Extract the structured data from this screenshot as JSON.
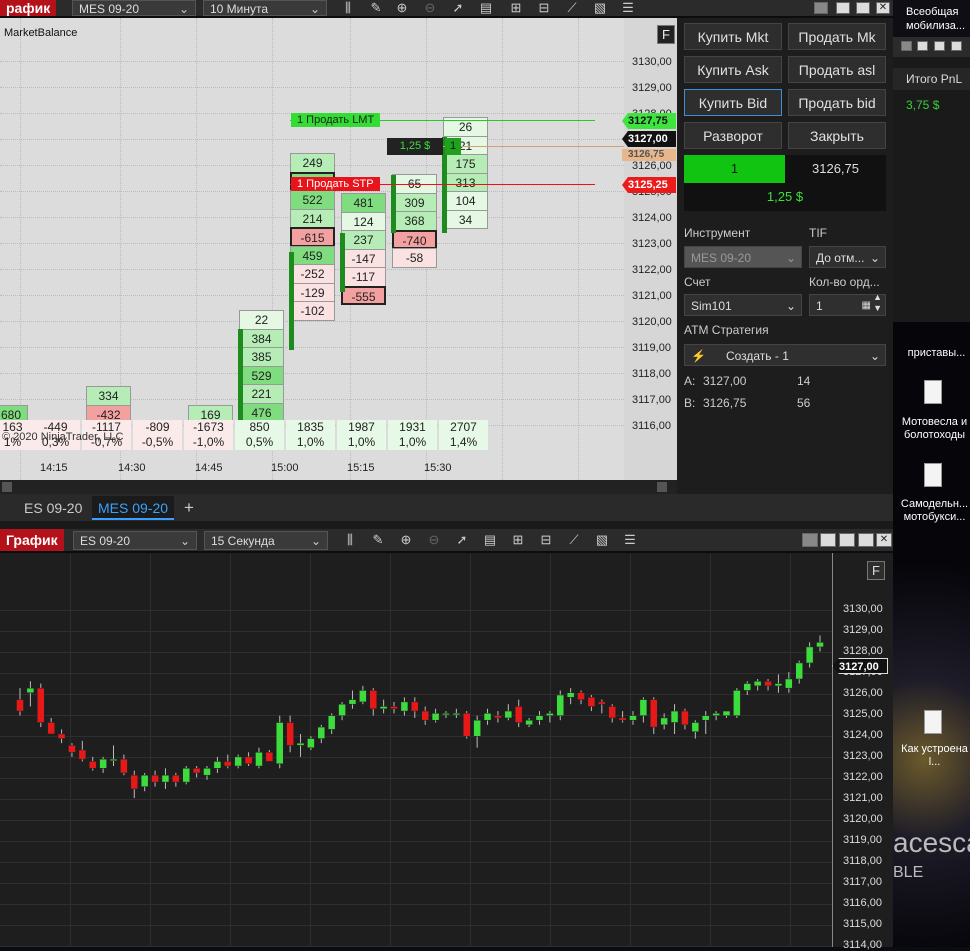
{
  "top_window": {
    "title": "рафик",
    "instrument": "MES 09-20",
    "interval": "10 Минута",
    "indicator_label": "MarketBalance",
    "f_button": "F",
    "copyright": "© 2020 NinjaTrader, LLC"
  },
  "top_axis": [
    "3130,00",
    "3129,00",
    "3128,00",
    "3127,00",
    "3126,00",
    "3125,00",
    "3124,00",
    "3123,00",
    "3122,00",
    "3121,00",
    "3120,00",
    "3119,00",
    "3118,00",
    "3117,00",
    "3116,00"
  ],
  "top_time_labels": [
    "14:15",
    "14:30",
    "14:45",
    "15:00",
    "15:15",
    "15:30"
  ],
  "footprint_columns": [
    {
      "cells": [
        "680"
      ]
    },
    {
      "cells": [
        "334",
        "-432"
      ]
    },
    {
      "cells": [
        "169"
      ]
    },
    {
      "cells": [
        "22",
        "384",
        "385",
        "529",
        "221",
        "476"
      ]
    },
    {
      "cells": [
        "249",
        "590",
        "522",
        "214",
        "-615",
        "459",
        "-252",
        "-129",
        "-102"
      ]
    },
    {
      "cells": [
        "481",
        "124",
        "237",
        "-147",
        "-117",
        "-555"
      ]
    },
    {
      "cells": [
        "65",
        "309",
        "368",
        "-740",
        "-58"
      ]
    },
    {
      "cells": [
        "26",
        "21",
        "175",
        "313",
        "104",
        "34"
      ]
    }
  ],
  "volume_row": [
    "163",
    "-449",
    "-1117",
    "-809",
    "-1673",
    "850",
    "1835",
    "1987",
    "1931",
    "2707"
  ],
  "percent_row": [
    "1%",
    "0,3%",
    "-0,7%",
    "-0,5%",
    "-1,0%",
    "0,5%",
    "1,0%",
    "1,0%",
    "1,0%",
    "1,4%"
  ],
  "orders": {
    "sell_lmt": "1  Продать LMT",
    "sell_lmt_price": "3127,75",
    "sell_stp": "1  Продать STP",
    "sell_stp_price": "3125,25",
    "position_pnl": "1,25 $",
    "position_qty": "1",
    "last_price": "3127,00",
    "entry_price": "3126,75"
  },
  "trader": {
    "buy_mkt": "Купить Mkt",
    "sell_mkt": "Продать Mk",
    "buy_ask": "Купить Ask",
    "sell_ask": "Продать asl",
    "buy_bid": "Купить Bid",
    "sell_bid": "Продать bid",
    "reverse": "Разворот",
    "close": "Закрыть",
    "pos_qty": "1",
    "pos_price": "3126,75",
    "pnl": "1,25 $",
    "instrument_label": "Инструмент",
    "instrument_value": "MES 09-20",
    "tif_label": "TIF",
    "tif_value": "До отм...",
    "account_label": "Счет",
    "qty_label": "Кол-во орд...",
    "account_value": "Sim101",
    "qty_value": "1",
    "atm_label": "ATM Стратегия",
    "atm_value": "Создать - 1",
    "ask_label": "A:",
    "ask_price": "3127,00",
    "ask_size": "14",
    "bid_label": "B:",
    "bid_price": "3126,75",
    "bid_size": "56"
  },
  "tabs": [
    "ES 09-20",
    "MES 09-20",
    "+"
  ],
  "right_panel": {
    "news_title": "Всеобщая мобилиза...",
    "pnl_header": "Итого PnL",
    "pnl_value": "3,75 $",
    "item": "приставы...",
    "desktop_icons": [
      "Мотовесла и болотоходы",
      "Самодельн... мотобукси...",
      "Как устроена l..."
    ],
    "wallpaper_text": "acesca",
    "wallpaper_text2": "BLE"
  },
  "bottom_window": {
    "title": "График",
    "instrument": "ES 09-20",
    "interval": "15 Секунда",
    "f_button": "F",
    "last_price": "3127,00"
  },
  "bottom_axis": [
    "3130,00",
    "3129,00",
    "3128,00",
    "3127,00",
    "3126,00",
    "3125,00",
    "3124,00",
    "3123,00",
    "3122,00",
    "3121,00",
    "3120,00",
    "3119,00",
    "3118,00",
    "3117,00",
    "3116,00",
    "3115,00",
    "3114,00"
  ],
  "chart_data": {
    "type": "candlestick",
    "ylim": [
      3113.7,
      3130.9
    ],
    "candles": [
      [
        3124.5,
        3125.0,
        3123.8,
        3124.0
      ],
      [
        3124.8,
        3125.3,
        3124.2,
        3125.0
      ],
      [
        3125.0,
        3125.2,
        3123.3,
        3123.5
      ],
      [
        3123.5,
        3123.7,
        3123.0,
        3123.0
      ],
      [
        3123.0,
        3123.2,
        3122.6,
        3122.8
      ],
      [
        3122.5,
        3122.6,
        3122.0,
        3122.2
      ],
      [
        3122.3,
        3122.7,
        3121.8,
        3121.9
      ],
      [
        3121.8,
        3122.0,
        3121.4,
        3121.5
      ],
      [
        3121.5,
        3122.0,
        3121.3,
        3121.9
      ],
      [
        3121.9,
        3122.5,
        3121.6,
        3121.9
      ],
      [
        3121.9,
        3122.1,
        3121.2,
        3121.3
      ],
      [
        3121.2,
        3121.4,
        3120.2,
        3120.6
      ],
      [
        3120.7,
        3121.3,
        3120.5,
        3121.2
      ],
      [
        3121.2,
        3121.4,
        3120.7,
        3120.9
      ],
      [
        3120.9,
        3121.5,
        3120.6,
        3121.2
      ],
      [
        3121.2,
        3121.3,
        3120.7,
        3120.9
      ],
      [
        3120.9,
        3121.6,
        3120.8,
        3121.5
      ],
      [
        3121.5,
        3121.6,
        3121.1,
        3121.3
      ],
      [
        3121.2,
        3121.6,
        3121.0,
        3121.5
      ],
      [
        3121.5,
        3122.0,
        3121.3,
        3121.8
      ],
      [
        3121.8,
        3122.1,
        3121.5,
        3121.6
      ],
      [
        3121.6,
        3122.1,
        3121.5,
        3122.0
      ],
      [
        3122.0,
        3122.2,
        3121.6,
        3121.7
      ],
      [
        3121.6,
        3122.4,
        3121.5,
        3122.2
      ],
      [
        3122.2,
        3122.3,
        3121.8,
        3121.8
      ],
      [
        3121.7,
        3123.8,
        3121.5,
        3123.5
      ],
      [
        3123.5,
        3123.8,
        3122.2,
        3122.5
      ],
      [
        3122.5,
        3123.0,
        3122.0,
        3122.6
      ],
      [
        3122.4,
        3122.9,
        3122.3,
        3122.8
      ],
      [
        3122.8,
        3123.4,
        3122.6,
        3123.3
      ],
      [
        3123.2,
        3123.9,
        3123.0,
        3123.8
      ],
      [
        3123.8,
        3124.4,
        3123.6,
        3124.3
      ],
      [
        3124.3,
        3124.9,
        3124.1,
        3124.5
      ],
      [
        3124.4,
        3125.1,
        3124.3,
        3124.9
      ],
      [
        3124.9,
        3125.0,
        3123.8,
        3124.1
      ],
      [
        3124.1,
        3124.5,
        3123.9,
        3124.2
      ],
      [
        3124.2,
        3124.4,
        3123.9,
        3124.1
      ],
      [
        3124.0,
        3124.6,
        3123.8,
        3124.4
      ],
      [
        3124.4,
        3124.6,
        3123.7,
        3124.0
      ],
      [
        3124.0,
        3124.2,
        3123.4,
        3123.6
      ],
      [
        3123.6,
        3124.1,
        3123.5,
        3123.9
      ],
      [
        3123.9,
        3124.0,
        3123.7,
        3123.9
      ],
      [
        3123.9,
        3124.1,
        3123.7,
        3123.9
      ],
      [
        3123.9,
        3124.0,
        3122.8,
        3122.9
      ],
      [
        3122.9,
        3123.8,
        3122.4,
        3123.6
      ],
      [
        3123.6,
        3124.1,
        3123.4,
        3123.9
      ],
      [
        3123.8,
        3124.0,
        3123.5,
        3123.7
      ],
      [
        3123.7,
        3124.3,
        3123.6,
        3124.0
      ],
      [
        3124.2,
        3124.5,
        3123.3,
        3123.5
      ],
      [
        3123.4,
        3123.7,
        3123.3,
        3123.6
      ],
      [
        3123.6,
        3124.0,
        3123.4,
        3123.8
      ],
      [
        3123.8,
        3124.0,
        3123.5,
        3123.9
      ],
      [
        3123.8,
        3124.9,
        3123.6,
        3124.7
      ],
      [
        3124.6,
        3125.0,
        3124.3,
        3124.8
      ],
      [
        3124.8,
        3124.9,
        3124.3,
        3124.5
      ],
      [
        3124.6,
        3124.7,
        3124.0,
        3124.2
      ],
      [
        3124.4,
        3124.5,
        3123.9,
        3124.3
      ],
      [
        3124.2,
        3124.3,
        3123.5,
        3123.7
      ],
      [
        3123.7,
        3124.0,
        3123.5,
        3123.6
      ],
      [
        3123.6,
        3124.0,
        3123.4,
        3123.8
      ],
      [
        3123.8,
        3124.6,
        3123.5,
        3124.5
      ],
      [
        3124.5,
        3124.6,
        3123.0,
        3123.3
      ],
      [
        3123.4,
        3123.9,
        3123.2,
        3123.7
      ],
      [
        3123.5,
        3124.3,
        3123.0,
        3124.0
      ],
      [
        3124.0,
        3124.1,
        3123.2,
        3123.4
      ],
      [
        3123.1,
        3123.6,
        3122.8,
        3123.5
      ],
      [
        3123.6,
        3124.0,
        3123.0,
        3123.8
      ],
      [
        3123.8,
        3124.0,
        3123.6,
        3123.9
      ],
      [
        3123.8,
        3124.0,
        3123.7,
        3124.0
      ],
      [
        3123.8,
        3125.0,
        3123.7,
        3124.9
      ],
      [
        3124.9,
        3125.3,
        3124.7,
        3125.2
      ],
      [
        3125.1,
        3125.4,
        3124.9,
        3125.3
      ],
      [
        3125.3,
        3125.4,
        3124.9,
        3125.1
      ],
      [
        3125.1,
        3125.6,
        3124.8,
        3125.2
      ],
      [
        3125.0,
        3125.7,
        3124.8,
        3125.4
      ],
      [
        3125.4,
        3126.2,
        3125.2,
        3126.1
      ],
      [
        3126.1,
        3127.0,
        3125.9,
        3126.8
      ],
      [
        3126.8,
        3127.3,
        3126.6,
        3127.0
      ]
    ]
  }
}
